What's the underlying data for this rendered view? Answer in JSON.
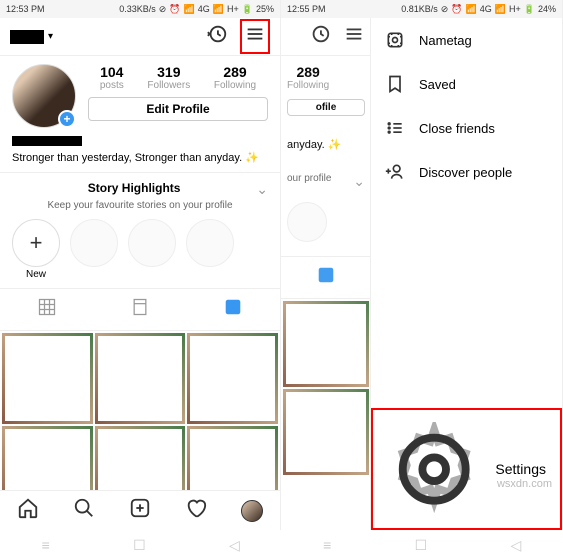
{
  "status": {
    "time_left": "12:53 PM",
    "speed_left": "0.33KB/s",
    "net_left": "4G",
    "net2_left": "H+",
    "battery_left": "25%",
    "time_right": "12:55 PM",
    "speed_right": "0.81KB/s",
    "net_right": "4G",
    "net2_right": "H+",
    "battery_right": "24%"
  },
  "profile": {
    "posts": "104",
    "posts_label": "posts",
    "followers": "319",
    "followers_label": "Followers",
    "following": "289",
    "following_label": "Following",
    "edit_label": "Edit Profile",
    "bio_text": "Stronger than yesterday, Stronger than anyday. ✨",
    "bio_text_partial": "anyday. ✨",
    "ofile_partial": "ofile"
  },
  "highlights": {
    "title": "Story Highlights",
    "subtitle": "Keep your favourite stories on your profile",
    "subtitle_partial": "our profile",
    "new_label": "New"
  },
  "drawer": {
    "nametag": "Nametag",
    "saved": "Saved",
    "close_friends": "Close friends",
    "discover": "Discover people",
    "settings": "Settings"
  },
  "watermark": "wsxdn.com"
}
